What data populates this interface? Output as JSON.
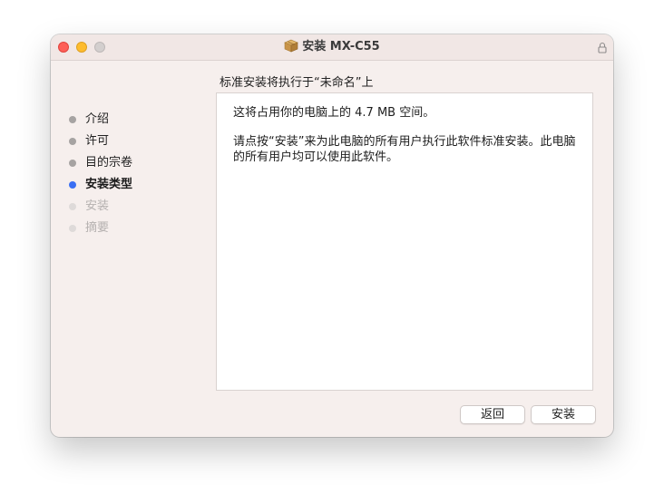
{
  "window": {
    "title": "安装 MX-C55",
    "icon": "package-icon",
    "lock_icon": "lock-icon"
  },
  "header": {
    "heading": "标准安装将执行于“未命名”上"
  },
  "sidebar": {
    "steps": [
      {
        "label": "介绍",
        "state": "done"
      },
      {
        "label": "许可",
        "state": "done"
      },
      {
        "label": "目的宗卷",
        "state": "done"
      },
      {
        "label": "安装类型",
        "state": "active"
      },
      {
        "label": "安装",
        "state": "future"
      },
      {
        "label": "摘要",
        "state": "future"
      }
    ]
  },
  "content": {
    "space_text": "这将占用你的电脑上的 4.7 MB 空间。",
    "instruction_text": "请点按“安装”来为此电脑的所有用户执行此软件标准安装。此电脑的所有用户均可以使用此软件。"
  },
  "buttons": {
    "back_label": "返回",
    "install_label": "安装"
  },
  "colors": {
    "active_dot": "#3a6ff3",
    "close": "#fe5f57",
    "minimize": "#febc2e",
    "zoom_disabled": "#d3cfce"
  }
}
